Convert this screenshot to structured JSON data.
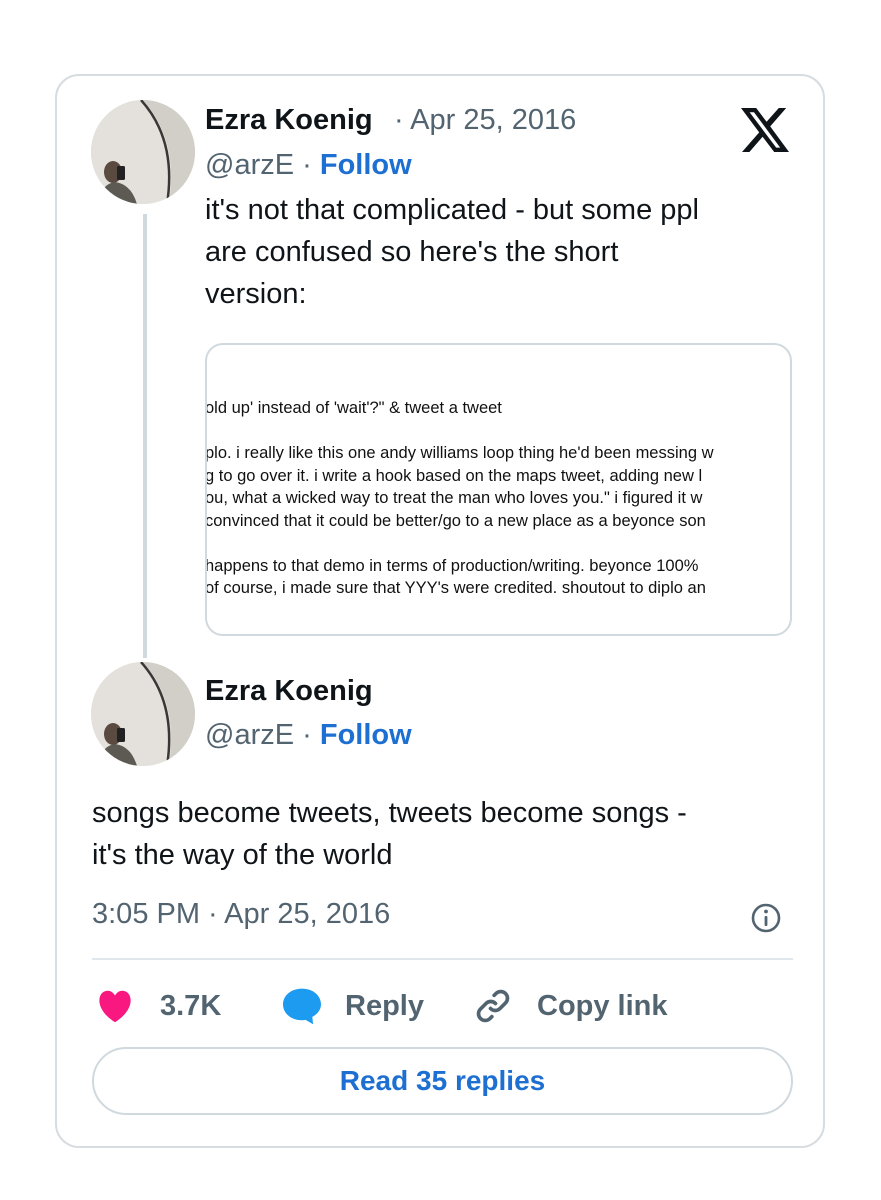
{
  "tweet_parent": {
    "author_name": "Ezra Koenig",
    "date_separator": "·",
    "date": "Apr 25, 2016",
    "handle": "@arzE",
    "handle_separator": "·",
    "follow_label": "Follow",
    "text_lines": [
      "it's not that complicated - but some ppl",
      "are confused so here's the short",
      "version:"
    ],
    "image_text_lines": [
      "old up' instead of 'wait'?\" & tweet a tweet",
      "",
      "plo. i really like this one andy williams loop thing he'd been messing w",
      "g to go over it. i write a hook based on the maps tweet, adding new l",
      "ou, what a wicked way to treat the man who loves you.\" i figured it w",
      "convinced that it could be better/go to a new place as a beyonce son",
      "",
      "happens to that demo in terms of production/writing. beyonce 100%",
      "of course, i made sure that YYY's were credited. shoutout to diplo an"
    ]
  },
  "tweet_main": {
    "author_name": "Ezra Koenig",
    "handle": "@arzE",
    "handle_separator": "·",
    "follow_label": "Follow",
    "text_lines": [
      "songs become tweets, tweets become songs -",
      "it's the way of the world"
    ],
    "timestamp": "3:05 PM · Apr 25, 2016"
  },
  "actions": {
    "likes_count": "3.7K",
    "reply_label": "Reply",
    "copy_link_label": "Copy link"
  },
  "read_replies_label": "Read 35 replies",
  "icons": {
    "brand": "x-logo-icon",
    "like": "heart-icon",
    "reply": "speech-bubble-icon",
    "copy": "link-icon",
    "info": "info-icon"
  },
  "colors": {
    "like": "#f91880",
    "reply": "#1d9bf0",
    "link_blue": "#1d6fd1",
    "muted": "#536471"
  }
}
